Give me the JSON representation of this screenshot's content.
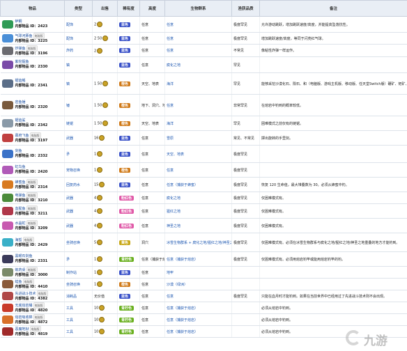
{
  "headers": [
    "物品",
    "类型",
    "出售",
    "稀有度",
    "高度",
    "生物群系",
    "渔获品质",
    "备注"
  ],
  "rows": [
    {
      "name": "鲈鲷",
      "id": "内部物品 ID：2423",
      "type": "配饰",
      "sell": "2",
      "rarity": "蓝色",
      "rc": "#3850c8",
      "height": "任意",
      "biome": "任意",
      "quality": "极度罕见",
      "note": "允许游动跳跃，增加跳跃速度/高度，并能提高坠落抗性。",
      "icon": "#2f9b56",
      "h": 22
    },
    {
      "name": "气球河豚鱼",
      "id": "内部物品 ID：3225",
      "badge": "电脑版",
      "type": "配饰",
      "sell": "2 50",
      "rarity": "蓝色",
      "rc": "#3850c8",
      "height": "任意",
      "biome": "任意",
      "quality": "极度罕见",
      "note": "增加跳跃速度/高度，等同于闪亮红气球。",
      "icon": "#4a8fd8",
      "h": 16
    },
    {
      "name": "炸弹鱼",
      "id": "内部物品 ID：3196",
      "badge": "电脑版",
      "type": "炸药",
      "sell": "2",
      "rarity": "蓝色",
      "rc": "#3850c8",
      "height": "任意",
      "biome": "任意",
      "quality": "不常见",
      "note": "像粘性炸弹一样运作。",
      "icon": "#6b6b70",
      "h": 17
    },
    {
      "name": "紫挖掘鱼",
      "id": "内部物品 ID：2330",
      "type": "镐",
      "sell": "",
      "rarity": "蓝色",
      "rc": "#3850c8",
      "height": "任意",
      "biome": "腐化之地",
      "quality": "罕见",
      "note": "",
      "icon": "#7a4aa8",
      "h": 22
    },
    {
      "name": "锯齿鳐",
      "id": "内部物品 ID：2341",
      "type": "镐",
      "sell": "1 50",
      "rarity": "橙色",
      "rc": "#d07a18",
      "height": "天空、地表",
      "biome": "海洋",
      "quality": "罕见",
      "note": "能够采挖沙漠化石、陨石、和（电脑版、游戏主机版、移动版、任天堂Switch版）硼矿、钯矿、钴矿、和铂金矿",
      "icon": "#5b6e88",
      "h": 30
    },
    {
      "name": "岩鱼锤",
      "id": "内部物品 ID：2320",
      "type": "锤",
      "sell": "1 50",
      "rarity": "橙色",
      "rc": "#d07a18",
      "height": "地下、洞穴、地狱",
      "biome": "任意",
      "quality": "非常罕见",
      "note": "在熔岩中钓到的概率较低。",
      "icon": "#7a5a3c",
      "h": 30
    },
    {
      "name": "锯齿鲨",
      "id": "内部物品 ID：2342",
      "type": "链锯",
      "sell": "1 50",
      "rarity": "橙色",
      "rc": "#d07a18",
      "height": "天空、地表",
      "biome": "海洋",
      "quality": "罕见",
      "note": "困难模式之前仅有的链锯。",
      "icon": "#8a9aa8",
      "h": 20
    },
    {
      "name": "幕府飞鱼",
      "id": "内部物品 ID：3197",
      "badge": "电脑版",
      "type": "武器",
      "sell": "16",
      "rarity": "蓝色",
      "rc": "#3850c8",
      "height": "任意",
      "biome": "雪原",
      "quality": "常见、不常见",
      "note": "掷出旋转的手里剑。",
      "icon": "#c04040",
      "h": 20
    },
    {
      "name": "剑鱼",
      "id": "内部物品 ID：2332",
      "type": "矛",
      "sell": "1",
      "rarity": "蓝色",
      "rc": "#3850c8",
      "height": "任意",
      "biome": "天空、地表",
      "quality": "极度罕见",
      "note": "",
      "icon": "#3a72c8",
      "h": 24
    },
    {
      "name": "虹鸟鱼",
      "id": "内部物品 ID：2420",
      "type": "宠物召唤",
      "sell": "1",
      "rarity": "橙色",
      "rc": "#d07a18",
      "height": "任意",
      "biome": "任意",
      "quality": "极度罕见",
      "note": "",
      "icon": "#b05ab8",
      "h": 20
    },
    {
      "name": "蜂蜜鱼",
      "id": "内部物品 ID：2314",
      "badge": "电脑版",
      "type": "回复药水",
      "sell": "15",
      "rarity": "蓝色",
      "rc": "#3850c8",
      "height": "任意",
      "biome": "任意（捕获于蜂蜜）",
      "quality": "极度罕见",
      "note": "恢复 120 生命值，最大堆叠数为 30。必须从蜂蜜中钓。",
      "icon": "#d87a20",
      "h": 20
    },
    {
      "name": "电弹鱼",
      "id": "内部物品 ID：3210",
      "badge": "电脑版",
      "type": "武器",
      "sell": "4",
      "rarity": "粉红色",
      "rc": "#e05aa8",
      "height": "任意",
      "biome": "腐化之地",
      "quality": "极度罕见",
      "note": "仅困难模式有。",
      "icon": "#4a8a3a",
      "h": 14
    },
    {
      "name": "血猩鱼",
      "id": "内部物品 ID：3211",
      "badge": "电脑版",
      "type": "武器",
      "sell": "4",
      "rarity": "粉红色",
      "rc": "#e05aa8",
      "height": "任意",
      "biome": "猩红之地",
      "quality": "极度罕见",
      "note": "仅困难模式有。",
      "icon": "#b0384a",
      "h": 20
    },
    {
      "name": "水晶蛇",
      "id": "内部物品 ID：3209",
      "badge": "电脑版",
      "type": "武器",
      "sell": "4",
      "rarity": "粉红色",
      "rc": "#e05aa8",
      "height": "任意",
      "biome": "神圣之地",
      "quality": "极度罕见",
      "note": "仅困难模式有。",
      "icon": "#c85ab0",
      "h": 20
    },
    {
      "name": "海蜇",
      "id": "内部物品 ID：2429",
      "badge": "电脑版",
      "type": "坐骑召唤",
      "sell": "5",
      "rarity": "黄色",
      "rc": "#c8a818",
      "height": "洞穴",
      "biome": "冰雪生物群系 + 腐化之地/猩红之地/神圣之地",
      "quality": "极度罕见",
      "note": "仅困难模式有。必须在冰雪生物群系与腐化之地/猩红之地/神圣之地重叠的地方才能钓到。",
      "icon": "#3ab0c8",
      "h": 26
    },
    {
      "name": "黑曜石剑鱼",
      "id": "内部物品 ID：2331",
      "type": "矛",
      "sell": "1",
      "rarity": "青柠色",
      "rc": "#6ab020",
      "height": "任意（捕获于熔岩）",
      "biome": "任意（捕获于熔岩）",
      "quality": "极度罕见",
      "note": "仅困难模式有。必须用熔岩钓竿或能用熔岩钓竿的钓。",
      "icon": "#3a3a5a",
      "h": 20
    },
    {
      "name": "炼药桌",
      "id": "内部物品 ID：3000",
      "badge": "电脑版",
      "type": "制作站",
      "sell": "1",
      "rarity": "蓝色",
      "rc": "#3850c8",
      "height": "任意",
      "biome": "地牢",
      "quality": "",
      "note": "",
      "icon": "#7a8a6a",
      "h": 14
    },
    {
      "name": "蛙鱼",
      "id": "内部物品 ID：4410",
      "badge": "电脑版",
      "type": "坐骑召唤",
      "sell": "1",
      "rarity": "橙色",
      "rc": "#d07a18",
      "height": "任意",
      "biome": "沙漠（绿洲）",
      "quality": "",
      "note": "",
      "icon": "#8a5a3a",
      "h": 10
    },
    {
      "name": "先进战斗技术",
      "id": "内部物品 ID：4382",
      "badge": "电脑版",
      "type": "消耗品",
      "sell": "无价值",
      "rarity": "蓝色",
      "rc": "#3850c8",
      "height": "任意",
      "biome": "任意",
      "quality": "极度罕见",
      "note": "只能在血月时才能钓到。如果在当前世界中已经用过了先进战斗技术则不会出现。",
      "icon": "#b04848",
      "h": 12
    },
    {
      "name": "无底熔岩桶",
      "id": "内部物品 ID：4820",
      "badge": "电脑版",
      "type": "工具",
      "sell": "10",
      "rarity": "青柠色",
      "rc": "#6ab020",
      "height": "任意",
      "biome": "任意（捕获于熔岩）",
      "quality": "",
      "note": "必须从熔岩中钓到。",
      "icon": "#c83a2a",
      "h": 12
    },
    {
      "name": "熔岩吸收棉",
      "id": "内部物品 ID：4872",
      "badge": "电脑版",
      "type": "工具",
      "sell": "10",
      "rarity": "青柠色",
      "rc": "#6ab020",
      "height": "任意",
      "biome": "任意（捕获于熔岩）",
      "quality": "",
      "note": "必须从熔岩中钓到。",
      "icon": "#d8702a",
      "h": 12
    },
    {
      "name": "恶魔地狱",
      "id": "内部物品 ID：4819",
      "badge": "电脑版",
      "type": "工具",
      "sell": "10",
      "rarity": "青柠色",
      "rc": "#6ab020",
      "height": "任意",
      "biome": "任意（捕获于熔岩）",
      "quality": "",
      "note": "必须从熔岩中钓到。",
      "icon": "#a02a2a",
      "h": 12
    }
  ],
  "watermark": "九游"
}
